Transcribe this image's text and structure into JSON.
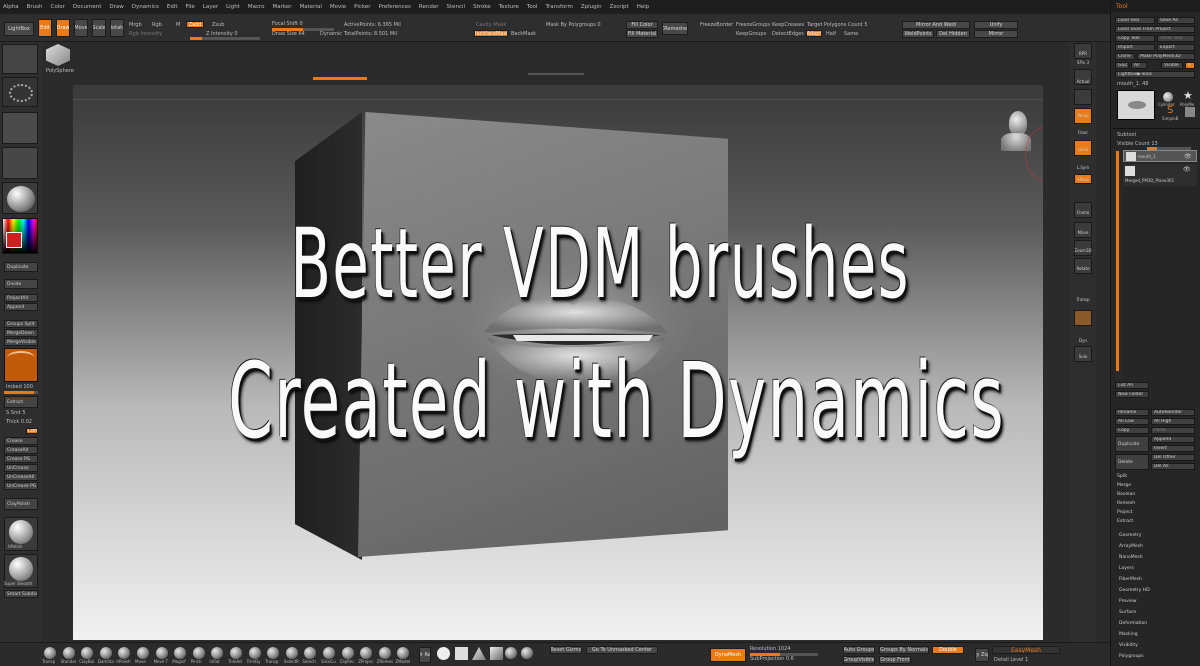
{
  "menu": [
    "Alpha",
    "Brush",
    "Color",
    "Document",
    "Draw",
    "Dynamics",
    "Edit",
    "File",
    "Layer",
    "Light",
    "Macro",
    "Marker",
    "Material",
    "Movie",
    "Picker",
    "Preferences",
    "Render",
    "Stencil",
    "Stroke",
    "Texture",
    "Tool",
    "Transform",
    "Zplugin",
    "Zscript",
    "Help"
  ],
  "shelf": {
    "lightbox": "LightBox",
    "edit": "Edit",
    "draw": "Draw",
    "move": "Move",
    "scale": "Scale",
    "rotate": "Rotate",
    "mrgb": "Mrgb",
    "rgb": "Rgb",
    "m": "M",
    "zadd": "Zadd",
    "zsub": "Zsub",
    "rgb_intensity": "Rgb Intensity",
    "z_intensity": "Z Intensity 0",
    "focal_shift": "Focal Shift 0",
    "draw_size": "Draw Size 64",
    "dynamic": "Dynamic",
    "active_points": "ActivePoints: 6.365 Mil",
    "total_points": "TotalPoints: 8.501 Mil",
    "backface_mask": "BackfaceMask",
    "backmask": "BackMask",
    "mask_by_polygroups": "Mask By Polygroups 0",
    "fill_color": "Fill Color",
    "fill_material": "Fill Material",
    "zremesher": "ZRemesher",
    "freeze_border": "FreezeBorder",
    "freeze_groups": "FreezeGroups",
    "keep_creases": "KeepCreases",
    "target_polygons": "Target Polygons Count 5",
    "keep_groups": "KeepGroups",
    "detect_edges": "DetectEdges",
    "adapt": "Adapt",
    "half": "Half",
    "same": "Same",
    "mirror_and_weld": "Mirror And Weld",
    "weld_points": "WeldPoints",
    "del_hidden": "Del Hidden",
    "unify": "Unify",
    "mirror": "Mirror",
    "polysphere": "PolySphere"
  },
  "left": {
    "duplicate": "Duplicate",
    "divide": "Divide",
    "project_all": "ProjectAll",
    "append": "Append",
    "groups_split": "Groups Split",
    "merge_down": "MergeDown",
    "merge_visible": "MergeVisible",
    "imbed": "Imbed 100",
    "extract": "Extract",
    "s_smt": "S Smt 5",
    "thick": "Thick 0.02",
    "crease": "Crease",
    "crease_all": "CreaseAll",
    "crease_pg": "Crease PG",
    "uncrease": "UnCrease",
    "uncrease_all": "UnCreaseAll",
    "uncrease_pg": "UnCrease PG",
    "claypolish": "ClayPolish",
    "brush_label": "hPolish",
    "smooth_label": "Super Smooth",
    "smart_subdiv": "Smart Subdiv"
  },
  "title": {
    "line1": "Better VDM brushes",
    "line2": "Created with Dynamics"
  },
  "right": {
    "bpr": "BPR",
    "spix": "SPix 3",
    "actual": "Actual",
    "persp": "Persp",
    "floor": "Floor",
    "local": "Local",
    "lsym": "L.Sym",
    "xpose": "XPose",
    "frame": "Frame",
    "move": "Move",
    "zoom3d": "Zoom3D",
    "rotate": "Rotate",
    "transp": "Transp",
    "dyn": "Dyn",
    "solo": "Solo"
  },
  "tool": {
    "header": "Tool",
    "load_tool": "Load Tool",
    "save_as": "Save As",
    "load_from_project": "Load Tools From Project",
    "copy_tool": "Copy Tool",
    "paste_tool": "Paste Tool",
    "import": "Import",
    "export": "Export",
    "clone": "Clone",
    "make_polymesh": "Make PolyMesh3D",
    "goz": "GoZ",
    "all": "All",
    "visible": "Visible",
    "r": "R",
    "lightbox_tools": "Lightbox▶Tools",
    "mouth": "mouth_1. 48",
    "cylinder": "Cylinder",
    "polymesh": "PolyMe",
    "simple": "SimpleB",
    "subtool": "Subtool",
    "visible_count": "Visible Count 13",
    "sub1": "mouth_1",
    "sub2": "Merged_PM3D_Plane301",
    "list_all": "List All",
    "new_folder": "New Folder",
    "rename": "Rename",
    "auto_reorder": "AutoReorder",
    "all_low": "All Low",
    "all_high": "All High",
    "copy": "Copy",
    "paste": "Paste",
    "duplicate": "Duplicate",
    "append": "Append",
    "insert": "Insert",
    "delete": "Delete",
    "del_other": "Del Other",
    "del_all": "Del All",
    "split": "Split",
    "merge": "Merge",
    "boolean": "Boolean",
    "remesh": "Remesh",
    "project": "Project",
    "extract": "Extract",
    "sections": [
      "Geometry",
      "ArrayMesh",
      "NanoMesh",
      "Layers",
      "FiberMesh",
      "Geometry HD",
      "Preview",
      "Surface",
      "Deformation",
      "Masking",
      "Visibility",
      "Polygroups"
    ]
  },
  "bottom": {
    "brushes": [
      "Transp",
      "Standar",
      "ClayBui",
      "DamSta",
      "hPolish",
      "Move",
      "Move T",
      "Magnif",
      "Pinch",
      "Inflat",
      "TrimAd",
      "TrimDy",
      "Transp",
      "SelectR",
      "Selecti",
      "SliceCu",
      "ClipRec",
      "ZProjec",
      "ZRemes",
      "ZModel"
    ],
    "mrgb_label": "Mr Rec",
    "reset_gizmo": "Reset Gizmo",
    "go_to_center": "Go To Unmasked Center",
    "dynamesh": "DynaMesh",
    "resolution": "Resolution 1024",
    "subprojection": "SubProjection 0.6",
    "auto_groups": "Auto Groups",
    "groups_by_normals": "Groups By Normals",
    "group_visible": "GroupVisible",
    "group_front": "Group Front",
    "double": "Double",
    "easy_zsphere": "Easy Zsphe",
    "easymesh": "EasyMesh",
    "detail_level": "Detail Level 1"
  }
}
